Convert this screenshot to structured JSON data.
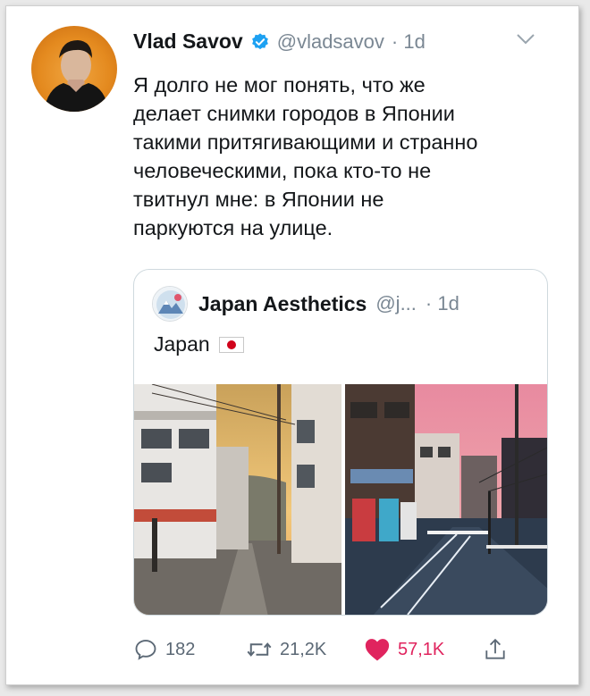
{
  "tweet": {
    "author_name": "Vlad Savov",
    "author_handle": "@vladsavov",
    "time": "· 1d",
    "text_lines": [
      "Я долго не мог понять, что же",
      "делает снимки городов в Японии",
      "такими притягивающими и странно",
      "человеческими, пока кто-то не",
      "твитнул мне: в Японии не",
      "паркуются на улице."
    ]
  },
  "quoted": {
    "author_name": "Japan Aesthetics",
    "author_handle": "@j...",
    "time": "· 1d",
    "text": "Japan",
    "flag_icon": "japan-flag-icon"
  },
  "actions": {
    "replies": "182",
    "retweets": "21,2K",
    "likes": "57,1K"
  },
  "colors": {
    "verified": "#1da1f2",
    "like": "#e0245e",
    "muted": "#7a8793"
  }
}
